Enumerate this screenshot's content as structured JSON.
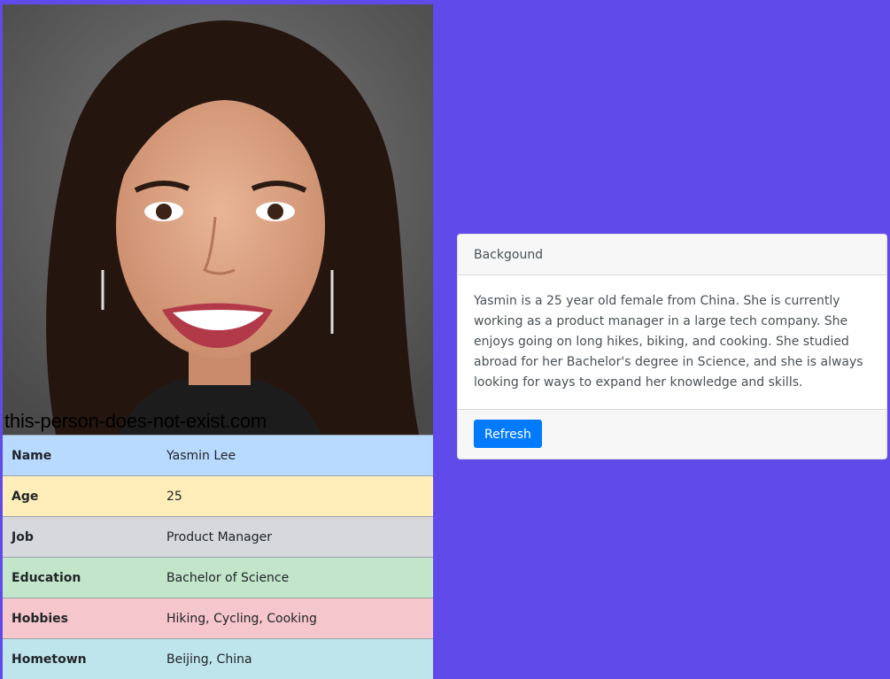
{
  "photo": {
    "watermark": "this-person-does-not-exist.com",
    "alt": "Portrait photo"
  },
  "profile": {
    "rows": [
      {
        "key": "Name",
        "value": "Yasmin Lee"
      },
      {
        "key": "Age",
        "value": "25"
      },
      {
        "key": "Job",
        "value": "Product Manager"
      },
      {
        "key": "Education",
        "value": "Bachelor of Science"
      },
      {
        "key": "Hobbies",
        "value": "Hiking, Cycling, Cooking"
      },
      {
        "key": "Hometown",
        "value": "Beijing, China"
      }
    ]
  },
  "background": {
    "header": "Backgound",
    "text": "Yasmin is a 25 year old female from China. She is currently working as a product manager in a large tech company. She enjoys going on long hikes, biking, and cooking. She studied abroad for her Bachelor's degree in Science, and she is always looking for ways to expand her knowledge and skills.",
    "refresh_label": "Refresh"
  },
  "colors": {
    "page_background": "#604bea",
    "button": "#007bff"
  }
}
